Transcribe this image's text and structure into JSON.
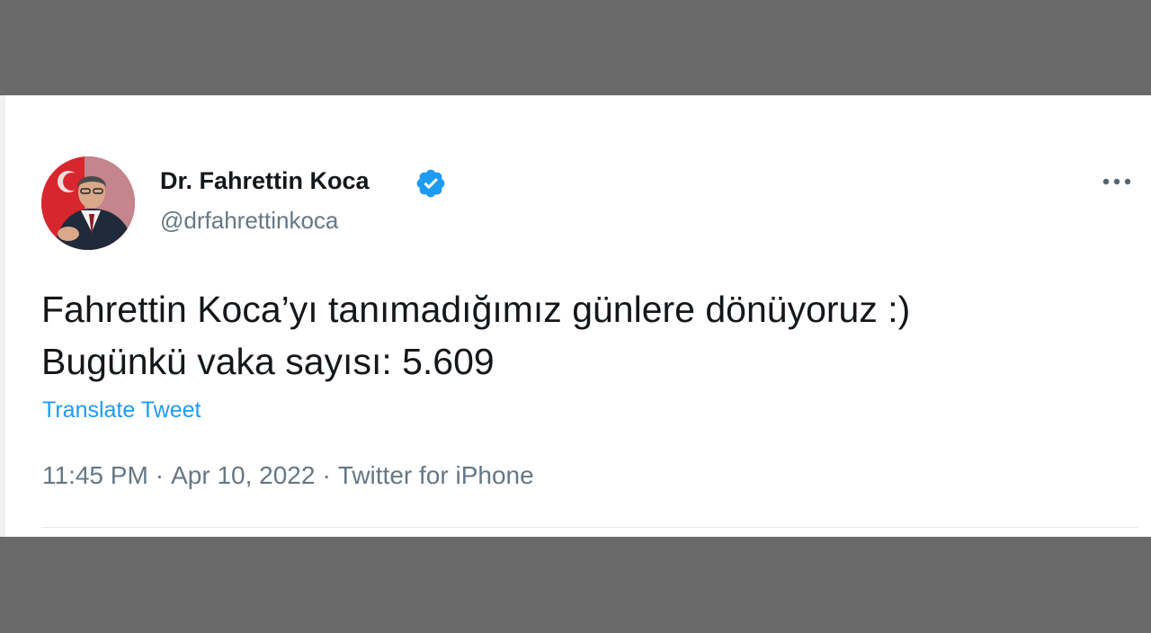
{
  "colors": {
    "backdrop": "#6b6a6b",
    "card": "#ffffff",
    "primary_text": "#14171a",
    "secondary_text": "#657786",
    "accent": "#1d9bf0"
  },
  "author": {
    "display_name": "Dr. Fahrettin Koca",
    "handle": "@drfahrettinkoca",
    "verified_icon": "verified-badge-icon",
    "avatar_icon": "avatar"
  },
  "tweet": {
    "lines": [
      "Fahrettin Koca’yı tanımadığımız günlere dönüyoruz :)",
      "Bugünkü vaka sayısı: 5.609"
    ],
    "translate_label": "Translate Tweet",
    "time": "11:45 PM",
    "date": "Apr 10, 2022",
    "source": "Twitter for iPhone",
    "separator": "·"
  },
  "menu": {
    "icon": "more-horizontal-icon"
  }
}
